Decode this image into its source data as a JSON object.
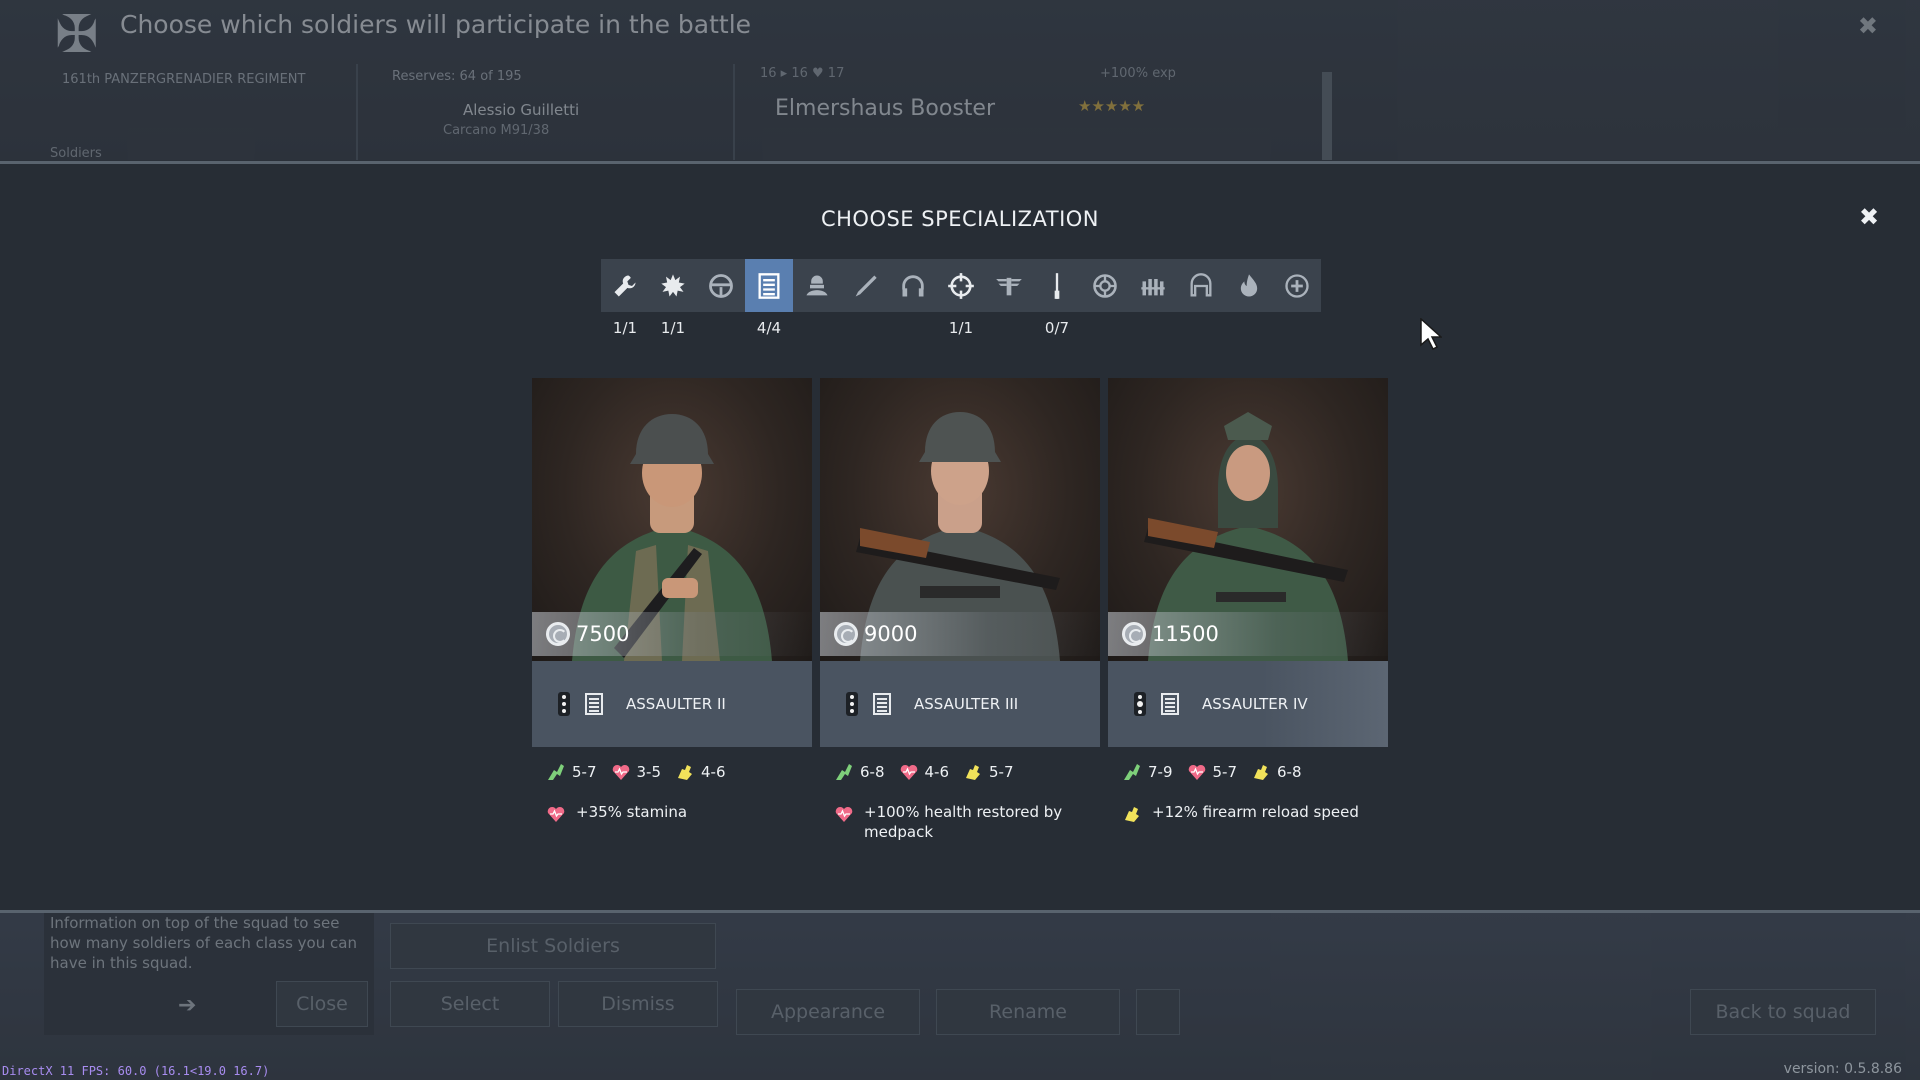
{
  "background": {
    "header_title": "Choose which soldiers will participate in the battle",
    "regiment": "161th PANZERGRENADIER REGIMENT",
    "reserves": "Reserves: 64 of 195",
    "soldier_name": "Alessio Guilletti",
    "soldier_weapon": "Carcano M91/38",
    "vehicle_stats": "16 ▸ 16 ♥ 17",
    "exp": "+100% exp",
    "vehicle_name": "Elmershaus Booster",
    "stars": "★★★★★",
    "soldiers_label": "Soldiers",
    "hint": "Information on top of the squad to see how many soldiers of each class you can have in this squad.",
    "close_label": "Close",
    "enlist_label": "Enlist Soldiers",
    "select_label": "Select",
    "dismiss_label": "Dismiss",
    "appearance_label": "Appearance",
    "rename_label": "Rename",
    "back_label": "Back to squad"
  },
  "modal": {
    "title": "CHOOSE SPECIALIZATION",
    "close_glyph": "✖"
  },
  "spec_tabs": [
    {
      "icon": "wrench-icon",
      "count": "1/1"
    },
    {
      "icon": "explosion-icon",
      "count": "1/1"
    },
    {
      "icon": "steering-wheel-icon",
      "count": ""
    },
    {
      "icon": "assaulter-list-icon",
      "count": "4/4",
      "active": true
    },
    {
      "icon": "trooper-icon",
      "count": ""
    },
    {
      "icon": "engineer-icon",
      "count": ""
    },
    {
      "icon": "radio-headset-icon",
      "count": ""
    },
    {
      "icon": "crosshair-icon",
      "count": "1/1"
    },
    {
      "icon": "pilot-wings-icon",
      "count": ""
    },
    {
      "icon": "rifleman-icon",
      "count": "0/7"
    },
    {
      "icon": "tanker-wheel-icon",
      "count": ""
    },
    {
      "icon": "ammo-belt-icon",
      "count": ""
    },
    {
      "icon": "parachute-icon",
      "count": ""
    },
    {
      "icon": "flame-icon",
      "count": ""
    },
    {
      "icon": "medic-plus-icon",
      "count": ""
    }
  ],
  "cards": [
    {
      "price": "7500",
      "class_name": "ASSAULTER II",
      "stats": {
        "agility": "5-7",
        "health": "3-5",
        "strength": "4-6"
      },
      "perk_icon": "health-icon",
      "perk": "+35% stamina"
    },
    {
      "price": "9000",
      "class_name": "ASSAULTER III",
      "stats": {
        "agility": "6-8",
        "health": "4-6",
        "strength": "5-7"
      },
      "perk_icon": "health-icon",
      "perk": "+100% health restored by medpack"
    },
    {
      "price": "11500",
      "class_name": "ASSAULTER IV",
      "stats": {
        "agility": "7-9",
        "health": "5-7",
        "strength": "6-8"
      },
      "perk_icon": "strength-icon",
      "perk": "+12% firearm reload speed"
    }
  ],
  "colors": {
    "agility": "#7ed07a",
    "health": "#f06a88",
    "strength": "#f1e25a",
    "active_tab": "#5a7fb0"
  },
  "footer": {
    "fps": "DirectX 11 FPS: 60.0 (16.1<19.0 16.7)",
    "version": "version: 0.5.8.86"
  }
}
